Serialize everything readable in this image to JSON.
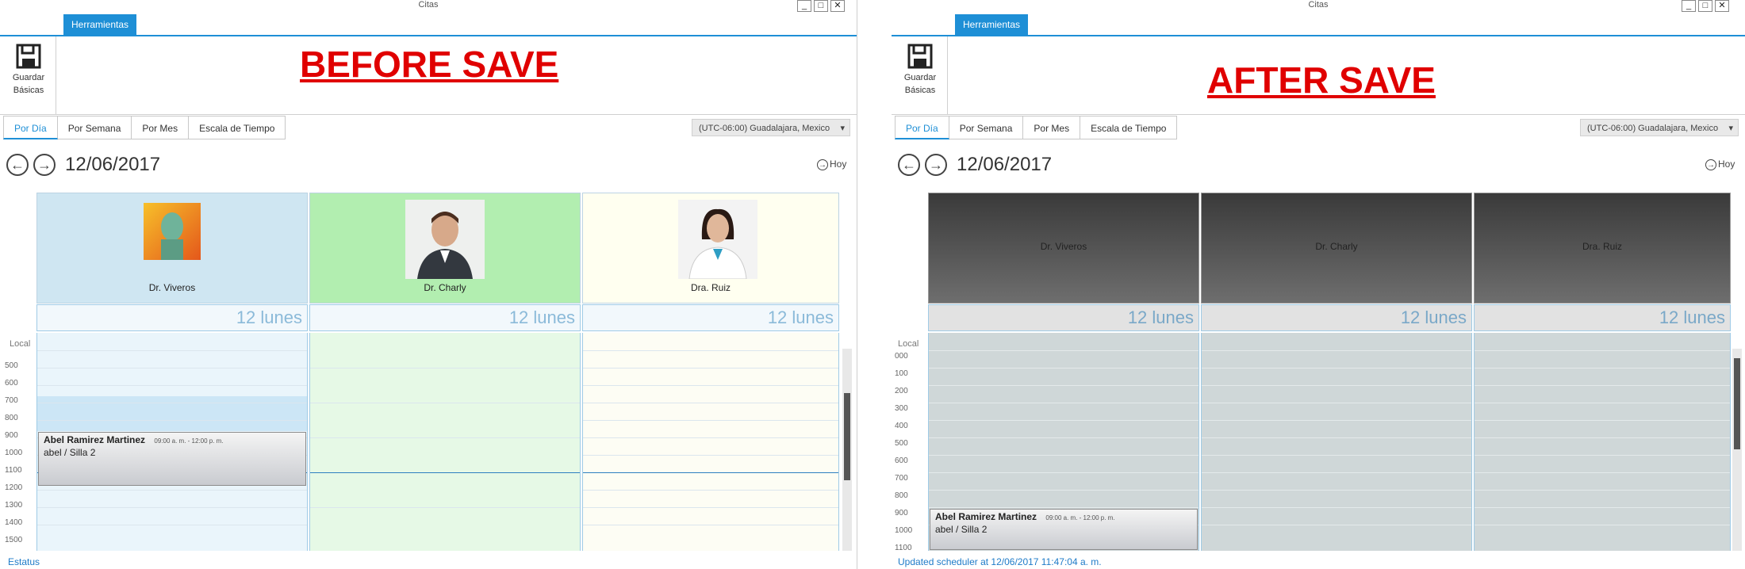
{
  "left": {
    "window_title": "Citas",
    "controls": [
      "_",
      "□",
      "✕"
    ],
    "ribbon_tab": "Herramientas",
    "save_button": "Guardar",
    "group_label": "Básicas",
    "banner": "BEFORE SAVE",
    "view_tabs": [
      "Por Día",
      "Por Semana",
      "Por Mes",
      "Escala de Tiempo"
    ],
    "timezone": "(UTC-06:00) Guadalajara, Mexico",
    "date": "12/06/2017",
    "today": "Hoy",
    "local_label": "Local",
    "resources": [
      {
        "name": "Dr. Viveros",
        "color": "#cfe6f2"
      },
      {
        "name": "Dr. Charly",
        "color": "#b2eeb0"
      },
      {
        "name": "Dra. Ruiz",
        "color": "#fffff0"
      }
    ],
    "day_header": "12 lunes",
    "hours": [
      "500",
      "600",
      "700",
      "800",
      "900",
      "1000",
      "1100",
      "1200",
      "1300",
      "1400",
      "1500"
    ],
    "appointment": {
      "name": "Abel Ramirez Martinez",
      "time": "09:00 a. m. - 12:00 p. m.",
      "detail": "abel / Silla 2"
    },
    "status": "Estatus"
  },
  "right": {
    "window_title": "Citas",
    "controls": [
      "_",
      "□",
      "✕"
    ],
    "ribbon_tab": "Herramientas",
    "save_button": "Guardar",
    "group_label": "Básicas",
    "banner": "AFTER SAVE",
    "view_tabs": [
      "Por Día",
      "Por Semana",
      "Por Mes",
      "Escala de Tiempo"
    ],
    "timezone": "(UTC-06:00) Guadalajara, Mexico",
    "date": "12/06/2017",
    "today": "Hoy",
    "local_label": "Local",
    "resources": [
      {
        "name": "Dr. Viveros"
      },
      {
        "name": "Dr. Charly"
      },
      {
        "name": "Dra. Ruiz"
      }
    ],
    "day_header": "12 lunes",
    "hours": [
      "000",
      "100",
      "200",
      "300",
      "400",
      "500",
      "600",
      "700",
      "800",
      "900",
      "1000",
      "1100"
    ],
    "appointment": {
      "name": "Abel Ramirez Martinez",
      "time": "09:00 a. m. - 12:00 p. m.",
      "detail": "abel / Silla 2"
    },
    "status": "Updated scheduler at 12/06/2017 11:47:04 a. m."
  }
}
